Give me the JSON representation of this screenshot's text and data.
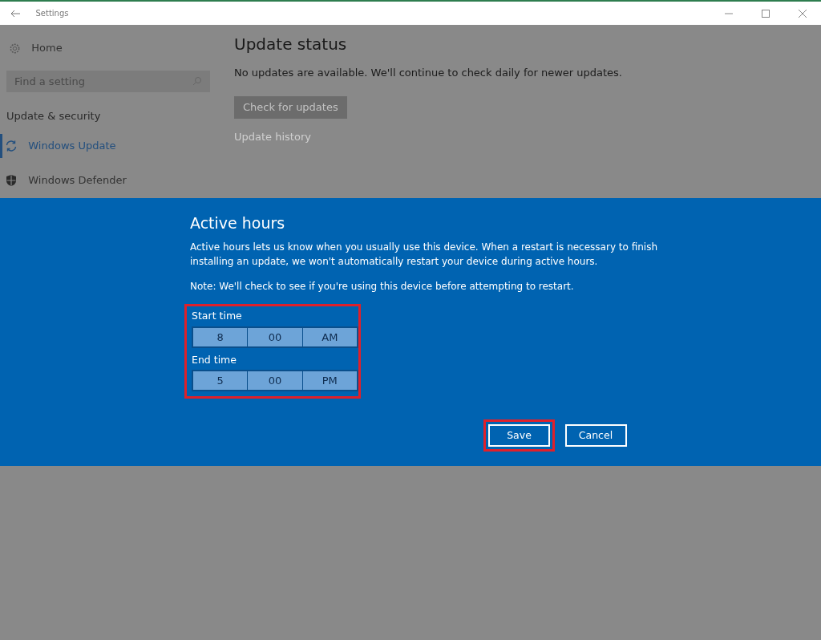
{
  "window": {
    "title": "Settings"
  },
  "sidebar": {
    "home": "Home",
    "search": {
      "placeholder": "Find a setting"
    },
    "section": "Update & security",
    "items": [
      {
        "label": "Windows Update",
        "selected": true,
        "kind": "sync"
      },
      {
        "label": "Windows Defender",
        "selected": false,
        "kind": "shield"
      }
    ]
  },
  "content": {
    "heading": "Update status",
    "message": "No updates are available. We'll continue to check daily for newer updates.",
    "button": "Check for updates",
    "link": "Update history"
  },
  "dialog": {
    "title": "Active hours",
    "description": "Active hours lets us know when you usually use this device. When a restart is necessary to finish installing an update, we won't automatically restart your device during active hours.",
    "note": "Note: We'll check to see if you're using this device before attempting to restart.",
    "times_highlighted": true,
    "times": [
      {
        "label": "Start time",
        "hour": "8",
        "minute": "00",
        "period": "AM"
      },
      {
        "label": "End time",
        "hour": "5",
        "minute": "00",
        "period": "PM"
      }
    ],
    "buttons": [
      {
        "label": "Save",
        "highlighted": true
      },
      {
        "label": "Cancel",
        "highlighted": false
      }
    ]
  }
}
